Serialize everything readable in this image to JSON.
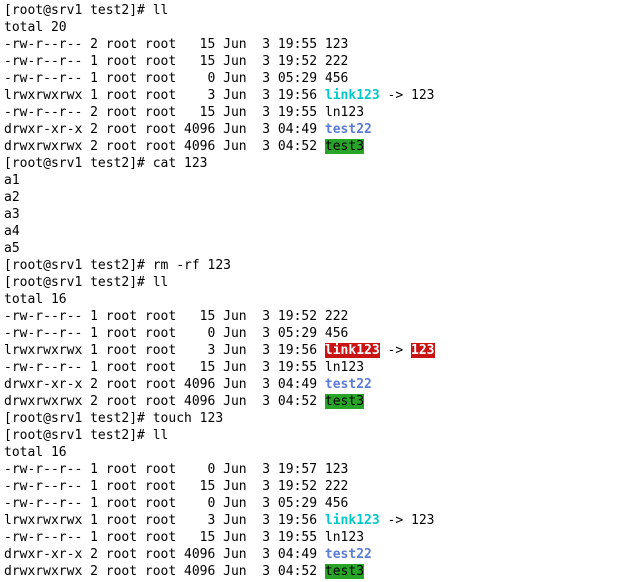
{
  "prompt": "[root@srv1 test2]# ",
  "cmd1": "ll",
  "total1": "total 20",
  "ls1": [
    {
      "perm": "-rw-r--r--",
      "ln": "2",
      "own": "root",
      "grp": "root",
      "size": "  15",
      "date": "Jun  3 19:55",
      "name": "123",
      "style": "plain"
    },
    {
      "perm": "-rw-r--r--",
      "ln": "1",
      "own": "root",
      "grp": "root",
      "size": "  15",
      "date": "Jun  3 19:52",
      "name": "222",
      "style": "plain"
    },
    {
      "perm": "-rw-r--r--",
      "ln": "1",
      "own": "root",
      "grp": "root",
      "size": "   0",
      "date": "Jun  3 05:29",
      "name": "456",
      "style": "plain"
    },
    {
      "perm": "lrwxrwxrwx",
      "ln": "1",
      "own": "root",
      "grp": "root",
      "size": "   3",
      "date": "Jun  3 19:56",
      "name": "link123",
      "style": "symlink",
      "target": "123",
      "target_style": "plain"
    },
    {
      "perm": "-rw-r--r--",
      "ln": "2",
      "own": "root",
      "grp": "root",
      "size": "  15",
      "date": "Jun  3 19:55",
      "name": "ln123",
      "style": "plain"
    },
    {
      "perm": "drwxr-xr-x",
      "ln": "2",
      "own": "root",
      "grp": "root",
      "size": "4096",
      "date": "Jun  3 04:49",
      "name": "test22",
      "style": "dir"
    },
    {
      "perm": "drwxrwxrwx",
      "ln": "2",
      "own": "root",
      "grp": "root",
      "size": "4096",
      "date": "Jun  3 04:52",
      "name": "test3",
      "style": "world-writable-dir"
    }
  ],
  "cmd2": "cat 123",
  "cat_output": [
    "a1",
    "a2",
    "a3",
    "a4",
    "a5"
  ],
  "cmd3": "rm -rf 123",
  "cmd4": "ll",
  "total2": "total 16",
  "ls2": [
    {
      "perm": "-rw-r--r--",
      "ln": "1",
      "own": "root",
      "grp": "root",
      "size": "  15",
      "date": "Jun  3 19:52",
      "name": "222",
      "style": "plain"
    },
    {
      "perm": "-rw-r--r--",
      "ln": "1",
      "own": "root",
      "grp": "root",
      "size": "   0",
      "date": "Jun  3 05:29",
      "name": "456",
      "style": "plain"
    },
    {
      "perm": "lrwxrwxrwx",
      "ln": "1",
      "own": "root",
      "grp": "root",
      "size": "   3",
      "date": "Jun  3 19:56",
      "name": "link123",
      "style": "broken",
      "target": "123",
      "target_style": "broken"
    },
    {
      "perm": "-rw-r--r--",
      "ln": "1",
      "own": "root",
      "grp": "root",
      "size": "  15",
      "date": "Jun  3 19:55",
      "name": "ln123",
      "style": "plain"
    },
    {
      "perm": "drwxr-xr-x",
      "ln": "2",
      "own": "root",
      "grp": "root",
      "size": "4096",
      "date": "Jun  3 04:49",
      "name": "test22",
      "style": "dir"
    },
    {
      "perm": "drwxrwxrwx",
      "ln": "2",
      "own": "root",
      "grp": "root",
      "size": "4096",
      "date": "Jun  3 04:52",
      "name": "test3",
      "style": "world-writable-dir"
    }
  ],
  "cmd5": "touch 123",
  "cmd6": "ll",
  "total3": "total 16",
  "ls3": [
    {
      "perm": "-rw-r--r--",
      "ln": "1",
      "own": "root",
      "grp": "root",
      "size": "   0",
      "date": "Jun  3 19:57",
      "name": "123",
      "style": "plain"
    },
    {
      "perm": "-rw-r--r--",
      "ln": "1",
      "own": "root",
      "grp": "root",
      "size": "  15",
      "date": "Jun  3 19:52",
      "name": "222",
      "style": "plain"
    },
    {
      "perm": "-rw-r--r--",
      "ln": "1",
      "own": "root",
      "grp": "root",
      "size": "   0",
      "date": "Jun  3 05:29",
      "name": "456",
      "style": "plain"
    },
    {
      "perm": "lrwxrwxrwx",
      "ln": "1",
      "own": "root",
      "grp": "root",
      "size": "   3",
      "date": "Jun  3 19:56",
      "name": "link123",
      "style": "symlink",
      "target": "123",
      "target_style": "plain"
    },
    {
      "perm": "-rw-r--r--",
      "ln": "1",
      "own": "root",
      "grp": "root",
      "size": "  15",
      "date": "Jun  3 19:55",
      "name": "ln123",
      "style": "plain"
    },
    {
      "perm": "drwxr-xr-x",
      "ln": "2",
      "own": "root",
      "grp": "root",
      "size": "4096",
      "date": "Jun  3 04:49",
      "name": "test22",
      "style": "dir"
    },
    {
      "perm": "drwxrwxrwx",
      "ln": "2",
      "own": "root",
      "grp": "root",
      "size": "4096",
      "date": "Jun  3 04:52",
      "name": "test3",
      "style": "world-writable-dir"
    }
  ]
}
